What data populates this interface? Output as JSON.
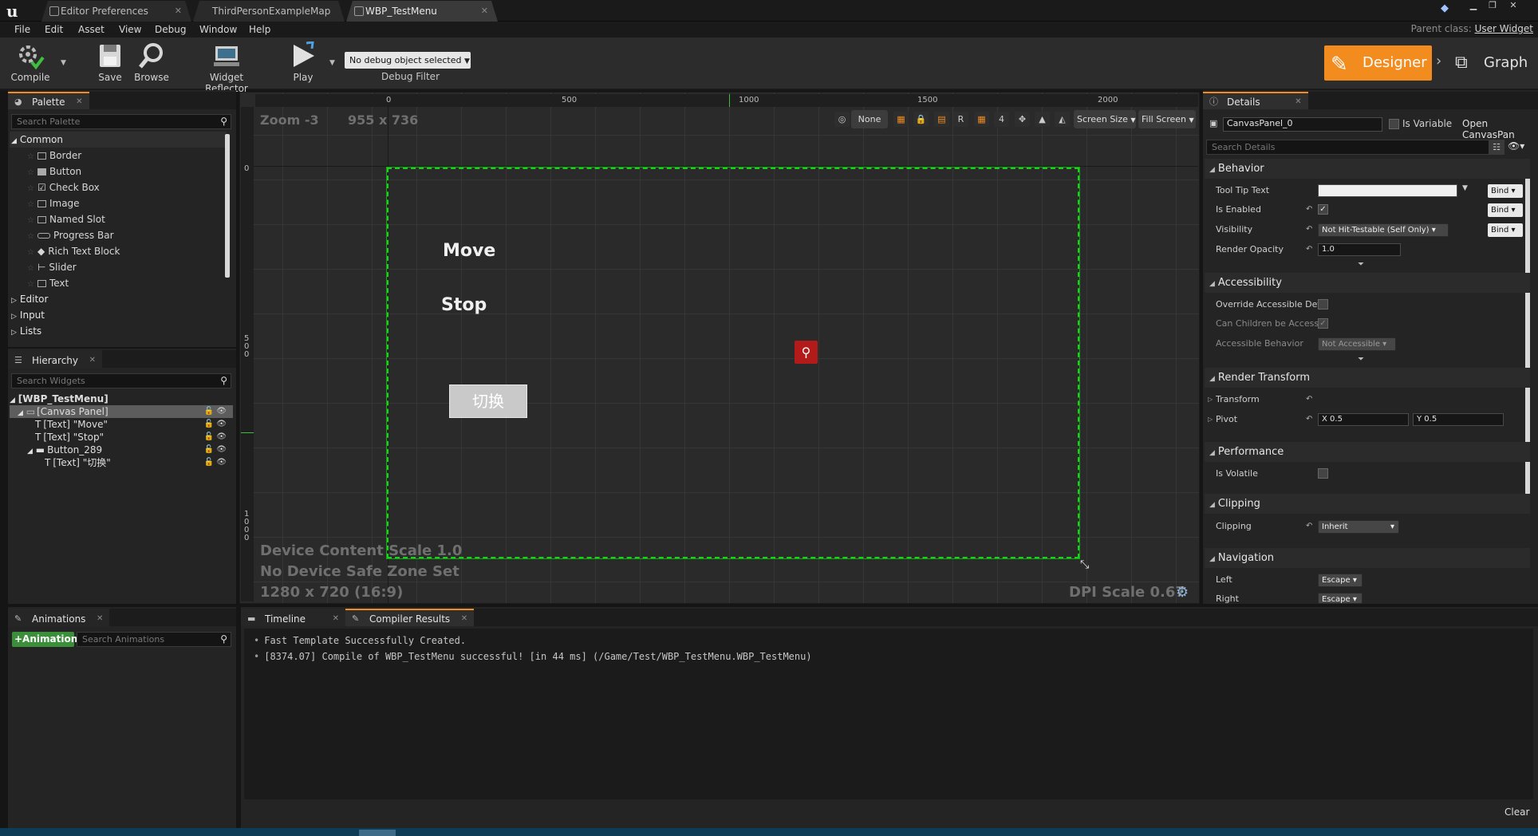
{
  "window": {
    "tabs": [
      {
        "label": "Editor Preferences",
        "active": false
      },
      {
        "label": "ThirdPersonExampleMap",
        "active": false
      },
      {
        "label": "WBP_TestMenu",
        "active": true
      }
    ],
    "parent_class_label": "Parent class:",
    "parent_class_value": "User Widget"
  },
  "menu": [
    "File",
    "Edit",
    "Asset",
    "View",
    "Debug",
    "Window",
    "Help"
  ],
  "toolbar": {
    "compile": "Compile",
    "save": "Save",
    "browse": "Browse",
    "widget_reflector": "Widget Reflector",
    "play": "Play",
    "debug_object": "No debug object selected",
    "debug_filter": "Debug Filter",
    "designer": "Designer",
    "graph": "Graph"
  },
  "palette": {
    "tab": "Palette",
    "search_placeholder": "Search Palette",
    "category_open": "Common",
    "items": [
      "Border",
      "Button",
      "Check Box",
      "Image",
      "Named Slot",
      "Progress Bar",
      "Rich Text Block",
      "Slider",
      "Text"
    ],
    "categories": [
      "Editor",
      "Input",
      "Lists"
    ]
  },
  "hierarchy": {
    "tab": "Hierarchy",
    "search_placeholder": "Search Widgets",
    "rows": [
      "[WBP_TestMenu]",
      "[Canvas Panel]",
      "[Text] \"Move\"",
      "[Text] \"Stop\"",
      "Button_289",
      "[Text] \"切换\""
    ]
  },
  "viewport": {
    "zoom": "Zoom -3",
    "size": "955 x 736",
    "ruler_h": [
      "0",
      "500",
      "1000",
      "1500",
      "2000"
    ],
    "ruler_v": [
      "0",
      "5\n0\n0",
      "1\n0\n0\n0"
    ],
    "toolbar_none": "None",
    "toolbar_r": "R",
    "toolbar_4": "4",
    "screen_size": "Screen Size",
    "fill_screen": "Fill Screen",
    "device_scale": "Device Content Scale 1.0",
    "safe_zone": "No Device Safe Zone Set",
    "resolution": "1280 x 720 (16:9)",
    "dpi_scale": "DPI Scale 0.67",
    "widgets": {
      "move": "Move",
      "stop": "Stop",
      "button": "切换"
    }
  },
  "details": {
    "tab": "Details",
    "name_value": "CanvasPanel_0",
    "is_variable": "Is Variable",
    "open_canvas": "Open CanvasPan",
    "search_placeholder": "Search Details",
    "sections": {
      "behavior": "Behavior",
      "accessibility": "Accessibility",
      "render_transform": "Render Transform",
      "performance": "Performance",
      "clipping": "Clipping",
      "navigation": "Navigation"
    },
    "labels": {
      "tool_tip": "Tool Tip Text",
      "is_enabled": "Is Enabled",
      "visibility": "Visibility",
      "render_opacity": "Render Opacity",
      "override_access": "Override Accessible Defa",
      "can_children": "Can Children be Accessil",
      "accessible_behavior": "Accessible Behavior",
      "transform": "Transform",
      "pivot": "Pivot",
      "is_volatile": "Is Volatile",
      "clipping": "Clipping",
      "left": "Left",
      "right": "Right"
    },
    "values": {
      "visibility": "Not Hit-Testable (Self Only)",
      "render_opacity": "1.0",
      "accessible_behavior": "Not Accessible",
      "pivot_x": "X  0.5",
      "pivot_y": "Y  0.5",
      "clipping": "Inherit",
      "left": "Escape",
      "right": "Escape",
      "bind": "Bind"
    }
  },
  "bottom": {
    "animations_tab": "Animations",
    "add_animation": "+Animation",
    "search_animations": "Search Animations",
    "timeline_tab": "Timeline",
    "compiler_tab": "Compiler Results",
    "log": [
      "Fast Template Successfully Created.",
      "[8374.07] Compile of WBP_TestMenu successful! [in 44 ms] (/Game/Test/WBP_TestMenu.WBP_TestMenu)"
    ],
    "clear": "Clear"
  }
}
